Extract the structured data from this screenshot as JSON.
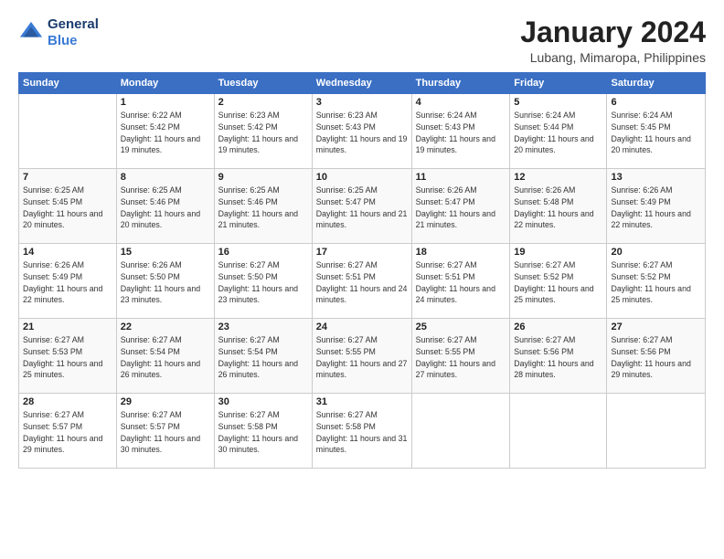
{
  "logo": {
    "line1": "General",
    "line2": "Blue"
  },
  "title": "January 2024",
  "subtitle": "Lubang, Mimaropa, Philippines",
  "days_of_week": [
    "Sunday",
    "Monday",
    "Tuesday",
    "Wednesday",
    "Thursday",
    "Friday",
    "Saturday"
  ],
  "weeks": [
    [
      {
        "day": "",
        "sunrise": "",
        "sunset": "",
        "daylight": ""
      },
      {
        "day": "1",
        "sunrise": "Sunrise: 6:22 AM",
        "sunset": "Sunset: 5:42 PM",
        "daylight": "Daylight: 11 hours and 19 minutes."
      },
      {
        "day": "2",
        "sunrise": "Sunrise: 6:23 AM",
        "sunset": "Sunset: 5:42 PM",
        "daylight": "Daylight: 11 hours and 19 minutes."
      },
      {
        "day": "3",
        "sunrise": "Sunrise: 6:23 AM",
        "sunset": "Sunset: 5:43 PM",
        "daylight": "Daylight: 11 hours and 19 minutes."
      },
      {
        "day": "4",
        "sunrise": "Sunrise: 6:24 AM",
        "sunset": "Sunset: 5:43 PM",
        "daylight": "Daylight: 11 hours and 19 minutes."
      },
      {
        "day": "5",
        "sunrise": "Sunrise: 6:24 AM",
        "sunset": "Sunset: 5:44 PM",
        "daylight": "Daylight: 11 hours and 20 minutes."
      },
      {
        "day": "6",
        "sunrise": "Sunrise: 6:24 AM",
        "sunset": "Sunset: 5:45 PM",
        "daylight": "Daylight: 11 hours and 20 minutes."
      }
    ],
    [
      {
        "day": "7",
        "sunrise": "Sunrise: 6:25 AM",
        "sunset": "Sunset: 5:45 PM",
        "daylight": "Daylight: 11 hours and 20 minutes."
      },
      {
        "day": "8",
        "sunrise": "Sunrise: 6:25 AM",
        "sunset": "Sunset: 5:46 PM",
        "daylight": "Daylight: 11 hours and 20 minutes."
      },
      {
        "day": "9",
        "sunrise": "Sunrise: 6:25 AM",
        "sunset": "Sunset: 5:46 PM",
        "daylight": "Daylight: 11 hours and 21 minutes."
      },
      {
        "day": "10",
        "sunrise": "Sunrise: 6:25 AM",
        "sunset": "Sunset: 5:47 PM",
        "daylight": "Daylight: 11 hours and 21 minutes."
      },
      {
        "day": "11",
        "sunrise": "Sunrise: 6:26 AM",
        "sunset": "Sunset: 5:47 PM",
        "daylight": "Daylight: 11 hours and 21 minutes."
      },
      {
        "day": "12",
        "sunrise": "Sunrise: 6:26 AM",
        "sunset": "Sunset: 5:48 PM",
        "daylight": "Daylight: 11 hours and 22 minutes."
      },
      {
        "day": "13",
        "sunrise": "Sunrise: 6:26 AM",
        "sunset": "Sunset: 5:49 PM",
        "daylight": "Daylight: 11 hours and 22 minutes."
      }
    ],
    [
      {
        "day": "14",
        "sunrise": "Sunrise: 6:26 AM",
        "sunset": "Sunset: 5:49 PM",
        "daylight": "Daylight: 11 hours and 22 minutes."
      },
      {
        "day": "15",
        "sunrise": "Sunrise: 6:26 AM",
        "sunset": "Sunset: 5:50 PM",
        "daylight": "Daylight: 11 hours and 23 minutes."
      },
      {
        "day": "16",
        "sunrise": "Sunrise: 6:27 AM",
        "sunset": "Sunset: 5:50 PM",
        "daylight": "Daylight: 11 hours and 23 minutes."
      },
      {
        "day": "17",
        "sunrise": "Sunrise: 6:27 AM",
        "sunset": "Sunset: 5:51 PM",
        "daylight": "Daylight: 11 hours and 24 minutes."
      },
      {
        "day": "18",
        "sunrise": "Sunrise: 6:27 AM",
        "sunset": "Sunset: 5:51 PM",
        "daylight": "Daylight: 11 hours and 24 minutes."
      },
      {
        "day": "19",
        "sunrise": "Sunrise: 6:27 AM",
        "sunset": "Sunset: 5:52 PM",
        "daylight": "Daylight: 11 hours and 25 minutes."
      },
      {
        "day": "20",
        "sunrise": "Sunrise: 6:27 AM",
        "sunset": "Sunset: 5:52 PM",
        "daylight": "Daylight: 11 hours and 25 minutes."
      }
    ],
    [
      {
        "day": "21",
        "sunrise": "Sunrise: 6:27 AM",
        "sunset": "Sunset: 5:53 PM",
        "daylight": "Daylight: 11 hours and 25 minutes."
      },
      {
        "day": "22",
        "sunrise": "Sunrise: 6:27 AM",
        "sunset": "Sunset: 5:54 PM",
        "daylight": "Daylight: 11 hours and 26 minutes."
      },
      {
        "day": "23",
        "sunrise": "Sunrise: 6:27 AM",
        "sunset": "Sunset: 5:54 PM",
        "daylight": "Daylight: 11 hours and 26 minutes."
      },
      {
        "day": "24",
        "sunrise": "Sunrise: 6:27 AM",
        "sunset": "Sunset: 5:55 PM",
        "daylight": "Daylight: 11 hours and 27 minutes."
      },
      {
        "day": "25",
        "sunrise": "Sunrise: 6:27 AM",
        "sunset": "Sunset: 5:55 PM",
        "daylight": "Daylight: 11 hours and 27 minutes."
      },
      {
        "day": "26",
        "sunrise": "Sunrise: 6:27 AM",
        "sunset": "Sunset: 5:56 PM",
        "daylight": "Daylight: 11 hours and 28 minutes."
      },
      {
        "day": "27",
        "sunrise": "Sunrise: 6:27 AM",
        "sunset": "Sunset: 5:56 PM",
        "daylight": "Daylight: 11 hours and 29 minutes."
      }
    ],
    [
      {
        "day": "28",
        "sunrise": "Sunrise: 6:27 AM",
        "sunset": "Sunset: 5:57 PM",
        "daylight": "Daylight: 11 hours and 29 minutes."
      },
      {
        "day": "29",
        "sunrise": "Sunrise: 6:27 AM",
        "sunset": "Sunset: 5:57 PM",
        "daylight": "Daylight: 11 hours and 30 minutes."
      },
      {
        "day": "30",
        "sunrise": "Sunrise: 6:27 AM",
        "sunset": "Sunset: 5:58 PM",
        "daylight": "Daylight: 11 hours and 30 minutes."
      },
      {
        "day": "31",
        "sunrise": "Sunrise: 6:27 AM",
        "sunset": "Sunset: 5:58 PM",
        "daylight": "Daylight: 11 hours and 31 minutes."
      },
      {
        "day": "",
        "sunrise": "",
        "sunset": "",
        "daylight": ""
      },
      {
        "day": "",
        "sunrise": "",
        "sunset": "",
        "daylight": ""
      },
      {
        "day": "",
        "sunrise": "",
        "sunset": "",
        "daylight": ""
      }
    ]
  ]
}
